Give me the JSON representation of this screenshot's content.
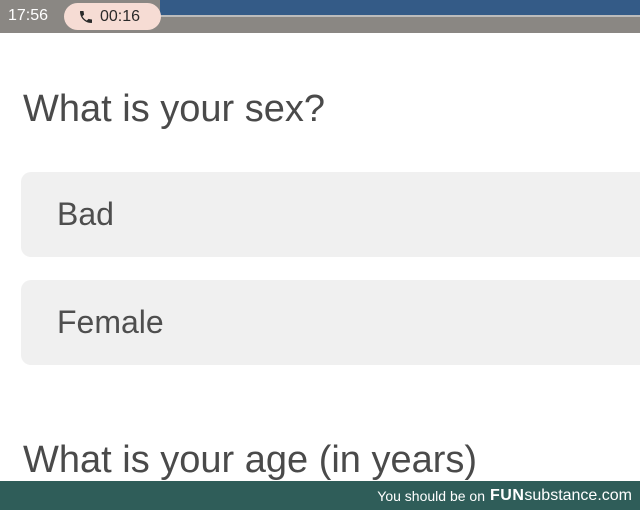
{
  "status_bar": {
    "time": "17:56",
    "call_duration": "00:16",
    "call_icon": "phone-icon"
  },
  "survey": {
    "question_sex": "What is your sex?",
    "options": [
      {
        "label": "Bad"
      },
      {
        "label": "Female"
      }
    ],
    "question_age": "What is your age (in years)"
  },
  "watermark": {
    "prefix": "You should be on",
    "brand_bold": "FUN",
    "brand_rest": "substance.com"
  }
}
